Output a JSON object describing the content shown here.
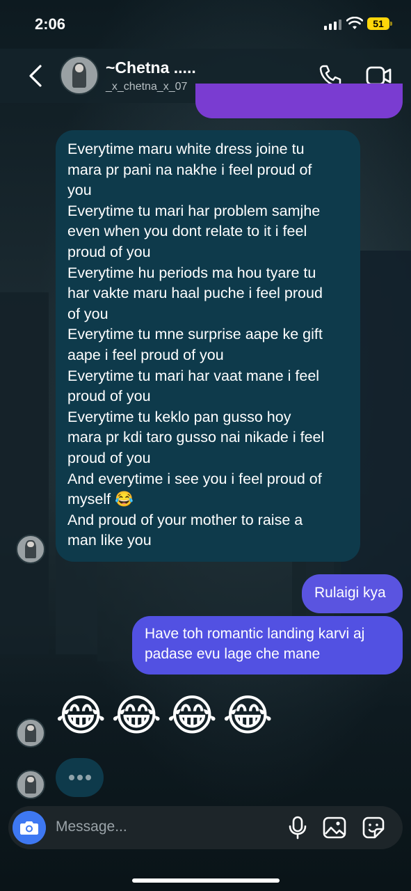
{
  "status_bar": {
    "time": "2:06",
    "battery": "51"
  },
  "header": {
    "name": "~Chetna .....",
    "handle": "_x_chetna_x_07"
  },
  "incoming_message": {
    "lines": [
      "Everytime maru white dress joine tu",
      "mara pr pani na nakhe i feel proud of",
      "you",
      "Everytime tu mari har problem samjhe",
      "even when you dont relate to it i feel",
      "proud of you",
      "Everytime hu periods ma hou tyare tu",
      "har vakte maru haal puche i feel proud",
      "of you",
      "Everytime tu mne surprise aape ke gift",
      "aape i feel proud of you",
      "Everytime tu mari har vaat mane i feel",
      "proud of you",
      "Everytime tu keklo pan gusso hoy",
      "mara pr kdi taro gusso nai nikade i feel",
      "proud of you",
      "And everytime i see you i feel proud of",
      "myself 😂",
      "And proud of your mother to raise a",
      "man like you"
    ]
  },
  "outgoing_messages": {
    "first": "Rulaigi kya",
    "second_line1": "Have toh romantic landing karvi aj",
    "second_line2": "padase evu lage che mane"
  },
  "emoji_message": {
    "emojis": [
      "😂",
      "😂",
      "😂",
      "😂"
    ]
  },
  "composer": {
    "placeholder": "Message..."
  },
  "colors": {
    "incoming_bubble": "#0e3a4b",
    "outgoing_bubble": "#5a54e0",
    "partial_bubble": "#7a3cd1"
  }
}
